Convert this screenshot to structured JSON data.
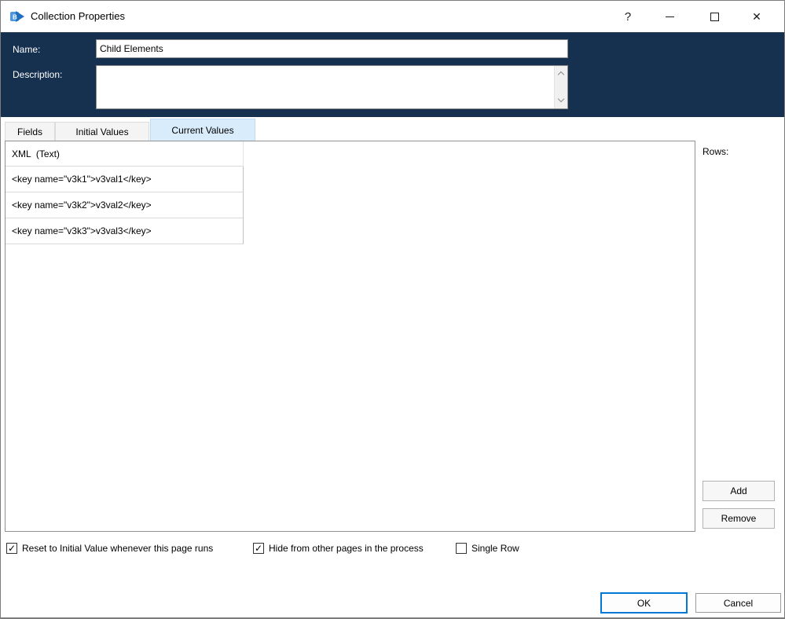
{
  "window": {
    "title": "Collection Properties",
    "controls": {
      "help_glyph": "?",
      "close_glyph": "✕"
    }
  },
  "header": {
    "name_label": "Name:",
    "name_value": "Child Elements",
    "description_label": "Description:",
    "description_value": ""
  },
  "tabs": [
    {
      "label": "Fields",
      "selected": false
    },
    {
      "label": "Initial Values",
      "selected": false
    },
    {
      "label": "Current Values",
      "selected": true
    }
  ],
  "grid": {
    "column_header": "XML  (Text)",
    "rows": [
      "<key name=\"v3k1\">v3val1</key>",
      "<key name=\"v3k2\">v3val2</key>",
      "<key name=\"v3k3\">v3val3</key>"
    ],
    "rows_label": "Rows:"
  },
  "side_buttons": {
    "add_label": "Add",
    "remove_label": "Remove"
  },
  "options": [
    {
      "label": "Reset to Initial Value whenever this page runs",
      "checked": true
    },
    {
      "label": "Hide from other pages in the process",
      "checked": true
    },
    {
      "label": "Single Row",
      "checked": false
    }
  ],
  "footer": {
    "ok_label": "OK",
    "cancel_label": "Cancel"
  },
  "icons": {
    "check_glyph": "✓"
  },
  "colors": {
    "header_navy": "#16304f",
    "selected_tab_blue": "#d9ecfb",
    "ok_border_blue": "#0078d7",
    "logo_blue": "#2f7fd0"
  }
}
